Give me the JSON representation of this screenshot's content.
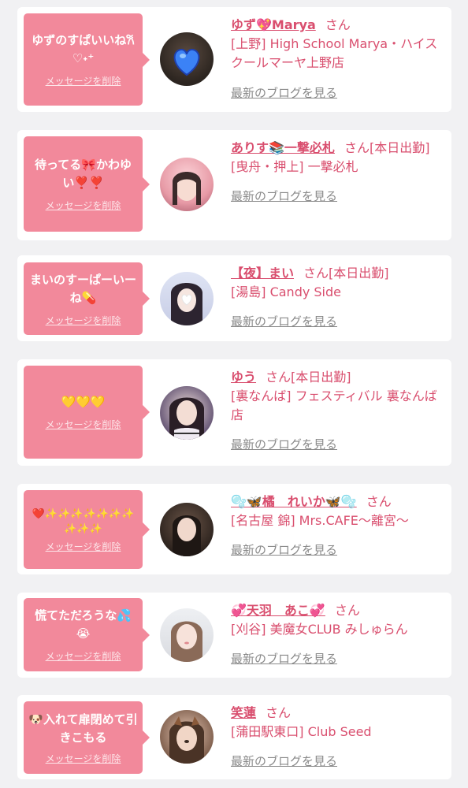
{
  "delete_label": "メッセージを削除",
  "blog_label": "最新のブログを見る",
  "san": "さん",
  "colors": {
    "bubble": "#f2899b",
    "accent": "#d94e6e",
    "muted": "#8a8a8a",
    "background": "#f1f1f3"
  },
  "cards": [
    {
      "message": "ゆずのすぱいいね𐙚♡˖⁺",
      "name": "ゆず💖Marya",
      "status": "",
      "shop": "[上野] High School Marya・ハイスクールマーヤ上野店",
      "avatar_icon": "blue-heart-icon"
    },
    {
      "message": "待ってる🎀かわゆい❣️❣️",
      "name": "ありす📚一撃必札",
      "status": "[本日出勤]",
      "shop": "[曳舟・押上] 一撃必札",
      "avatar_icon": "girl-photo"
    },
    {
      "message": "まいのすーぱーいーね💊",
      "name": "【夜】まい",
      "status": "[本日出勤]",
      "shop": "[湯島] Candy Side",
      "avatar_icon": "white-heart-icon"
    },
    {
      "message": "💛💛💛",
      "name": "ゆう",
      "status": "[本日出勤]",
      "shop": "[裏なんば] フェスティバル 裏なんば店",
      "avatar_icon": "girl-photo"
    },
    {
      "message": "❤️✨✨✨✨✨✨✨✨✨✨",
      "name": "🫧🦋橘　れいか🦋🫧",
      "status": "",
      "shop": "[名古屋 錦] Mrs.CAFE〜離宮〜",
      "avatar_icon": "girl-photo"
    },
    {
      "message": "慌てただろうな💦😭",
      "name": "💞天羽　あこ💞",
      "status": "",
      "shop": "[刈谷] 美魔女CLUB みしゅらん",
      "avatar_icon": "girl-photo"
    },
    {
      "message": "🐶入れて扉閉めて引きこもる",
      "name": "笑蓮",
      "status": "",
      "shop": "[蒲田駅東口] Club Seed",
      "avatar_icon": "girl-photo"
    }
  ]
}
